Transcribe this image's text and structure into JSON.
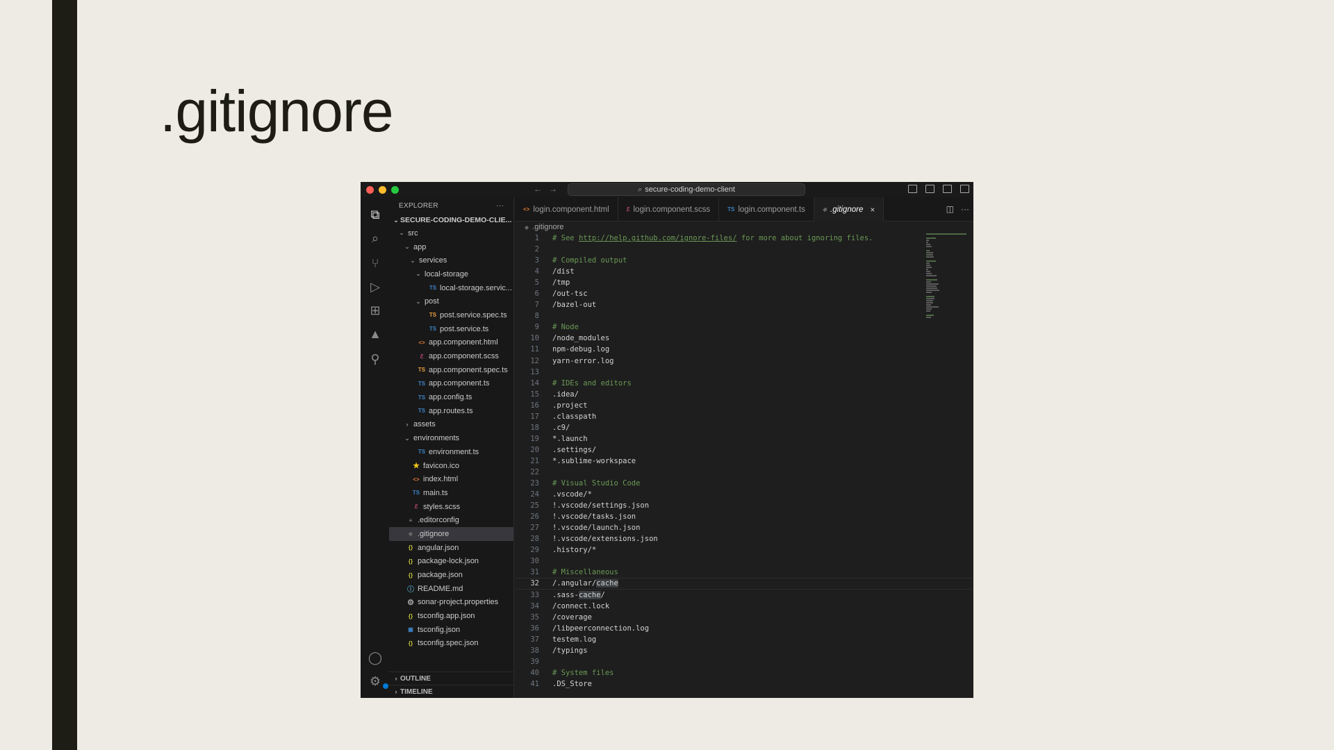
{
  "slide": {
    "title": ".gitignore"
  },
  "window": {
    "search": "secure-coding-demo-client",
    "nav_back": "←",
    "nav_forward": "→"
  },
  "activity_bar": [
    {
      "name": "explorer-icon",
      "glyph": "⧉"
    },
    {
      "name": "search-icon",
      "glyph": "⌕"
    },
    {
      "name": "source-control-icon",
      "glyph": "⑂"
    },
    {
      "name": "run-debug-icon",
      "glyph": "▷"
    },
    {
      "name": "extensions-icon",
      "glyph": "⊞"
    },
    {
      "name": "angular-icon",
      "glyph": "▲"
    },
    {
      "name": "git-graph-icon",
      "glyph": "⚲"
    }
  ],
  "activity_bottom": [
    {
      "name": "account-icon",
      "glyph": "◯"
    },
    {
      "name": "manage-icon",
      "glyph": "⚙"
    }
  ],
  "explorer": {
    "header": "EXPLORER",
    "more": "···",
    "project": "SECURE-CODING-DEMO-CLIE...",
    "items": [
      {
        "label": "src",
        "depth": 1,
        "twisty": "⌄",
        "icon": "",
        "cls": ""
      },
      {
        "label": "app",
        "depth": 2,
        "twisty": "⌄",
        "icon": "",
        "cls": ""
      },
      {
        "label": "services",
        "depth": 3,
        "twisty": "⌄",
        "icon": "",
        "cls": ""
      },
      {
        "label": "local-storage",
        "depth": 4,
        "twisty": "⌄",
        "icon": "",
        "cls": ""
      },
      {
        "label": "local-storage.servic...",
        "depth": 5,
        "twisty": "",
        "icon": "TS",
        "cls": "t-ts"
      },
      {
        "label": "post",
        "depth": 4,
        "twisty": "⌄",
        "icon": "",
        "cls": ""
      },
      {
        "label": "post.service.spec.ts",
        "depth": 5,
        "twisty": "",
        "icon": "TS",
        "cls": "t-spec"
      },
      {
        "label": "post.service.ts",
        "depth": 5,
        "twisty": "",
        "icon": "TS",
        "cls": "t-ts"
      },
      {
        "label": "app.component.html",
        "depth": 3,
        "twisty": "",
        "icon": "<>",
        "cls": "t-html"
      },
      {
        "label": "app.component.scss",
        "depth": 3,
        "twisty": "",
        "icon": "ℰ",
        "cls": "t-scss"
      },
      {
        "label": "app.component.spec.ts",
        "depth": 3,
        "twisty": "",
        "icon": "TS",
        "cls": "t-spec"
      },
      {
        "label": "app.component.ts",
        "depth": 3,
        "twisty": "",
        "icon": "TS",
        "cls": "t-ts"
      },
      {
        "label": "app.config.ts",
        "depth": 3,
        "twisty": "",
        "icon": "TS",
        "cls": "t-ts"
      },
      {
        "label": "app.routes.ts",
        "depth": 3,
        "twisty": "",
        "icon": "TS",
        "cls": "t-ts"
      },
      {
        "label": "assets",
        "depth": 2,
        "twisty": "›",
        "icon": "",
        "cls": ""
      },
      {
        "label": "environments",
        "depth": 2,
        "twisty": "⌄",
        "icon": "",
        "cls": ""
      },
      {
        "label": "environment.ts",
        "depth": 3,
        "twisty": "",
        "icon": "TS",
        "cls": "t-ts"
      },
      {
        "label": "favicon.ico",
        "depth": 2,
        "twisty": "",
        "icon": "★",
        "cls": "t-star"
      },
      {
        "label": "index.html",
        "depth": 2,
        "twisty": "",
        "icon": "<>",
        "cls": "t-html"
      },
      {
        "label": "main.ts",
        "depth": 2,
        "twisty": "",
        "icon": "TS",
        "cls": "t-ts"
      },
      {
        "label": "styles.scss",
        "depth": 2,
        "twisty": "",
        "icon": "ℰ",
        "cls": "t-scss"
      },
      {
        "label": ".editorconfig",
        "depth": 1,
        "twisty": "",
        "icon": "≡",
        "cls": "t-doc"
      },
      {
        "label": ".gitignore",
        "depth": 1,
        "twisty": "",
        "icon": "◆",
        "cls": "t-git",
        "selected": true
      },
      {
        "label": "angular.json",
        "depth": 1,
        "twisty": "",
        "icon": "{}",
        "cls": "t-json"
      },
      {
        "label": "package-lock.json",
        "depth": 1,
        "twisty": "",
        "icon": "{}",
        "cls": "t-json"
      },
      {
        "label": "package.json",
        "depth": 1,
        "twisty": "",
        "icon": "{}",
        "cls": "t-json"
      },
      {
        "label": "README.md",
        "depth": 1,
        "twisty": "",
        "icon": "ⓘ",
        "cls": "t-info"
      },
      {
        "label": "sonar-project.properties",
        "depth": 1,
        "twisty": "",
        "icon": "⚙",
        "cls": "t-gear"
      },
      {
        "label": "tsconfig.app.json",
        "depth": 1,
        "twisty": "",
        "icon": "{}",
        "cls": "t-json"
      },
      {
        "label": "tsconfig.json",
        "depth": 1,
        "twisty": "",
        "icon": "▦",
        "cls": "t-ts"
      },
      {
        "label": "tsconfig.spec.json",
        "depth": 1,
        "twisty": "",
        "icon": "{}",
        "cls": "t-json"
      }
    ],
    "outline": "OUTLINE",
    "timeline": "TIMELINE"
  },
  "tabs": [
    {
      "label": "login.component.html",
      "icon": "<>",
      "cls": "t-html",
      "active": false
    },
    {
      "label": "login.component.scss",
      "icon": "ℰ",
      "cls": "t-scss",
      "active": false
    },
    {
      "label": "login.component.ts",
      "icon": "TS",
      "cls": "t-ts",
      "active": false
    },
    {
      "label": ".gitignore",
      "icon": "◆",
      "cls": "t-git",
      "active": true
    }
  ],
  "tab_close": "×",
  "breadcrumb": ".gitignore",
  "current_line": 32,
  "code_lines": [
    {
      "text": "# See http://help.github.com/ignore-files/ for more about ignoring files.",
      "comment": true,
      "url": "http://help.github.com/ignore-files/"
    },
    {
      "text": ""
    },
    {
      "text": "# Compiled output",
      "comment": true
    },
    {
      "text": "/dist"
    },
    {
      "text": "/tmp"
    },
    {
      "text": "/out-tsc"
    },
    {
      "text": "/bazel-out"
    },
    {
      "text": ""
    },
    {
      "text": "# Node",
      "comment": true
    },
    {
      "text": "/node_modules"
    },
    {
      "text": "npm-debug.log"
    },
    {
      "text": "yarn-error.log"
    },
    {
      "text": ""
    },
    {
      "text": "# IDEs and editors",
      "comment": true
    },
    {
      "text": ".idea/"
    },
    {
      "text": ".project"
    },
    {
      "text": ".classpath"
    },
    {
      "text": ".c9/"
    },
    {
      "text": "*.launch"
    },
    {
      "text": ".settings/"
    },
    {
      "text": "*.sublime-workspace"
    },
    {
      "text": ""
    },
    {
      "text": "# Visual Studio Code",
      "comment": true
    },
    {
      "text": ".vscode/*"
    },
    {
      "text": "!.vscode/settings.json"
    },
    {
      "text": "!.vscode/tasks.json"
    },
    {
      "text": "!.vscode/launch.json"
    },
    {
      "text": "!.vscode/extensions.json"
    },
    {
      "text": ".history/*"
    },
    {
      "text": ""
    },
    {
      "text": "# Miscellaneous",
      "comment": true
    },
    {
      "text": "/.angular/cache",
      "highlight": "cache"
    },
    {
      "text": ".sass-cache/",
      "highlight": "cache"
    },
    {
      "text": "/connect.lock"
    },
    {
      "text": "/coverage"
    },
    {
      "text": "/libpeerconnection.log"
    },
    {
      "text": "testem.log"
    },
    {
      "text": "/typings"
    },
    {
      "text": ""
    },
    {
      "text": "# System files",
      "comment": true
    },
    {
      "text": ".DS_Store"
    }
  ]
}
